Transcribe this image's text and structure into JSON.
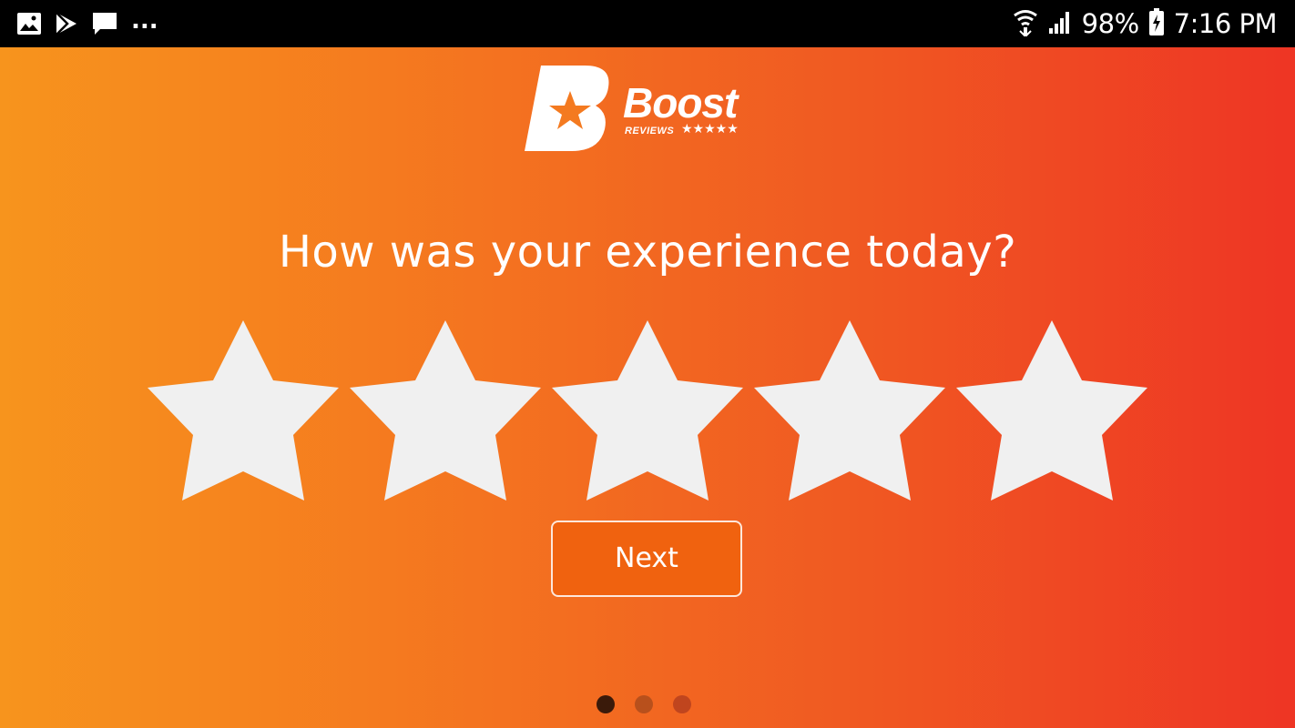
{
  "status_bar": {
    "left_icons": [
      "gallery-icon",
      "play-store-icon",
      "message-icon"
    ],
    "more_indicator": "...",
    "right_icons": [
      "wifi-icon",
      "signal-icon"
    ],
    "battery_percent": "98%",
    "battery_icon": "battery-charging-icon",
    "time": "7:16 PM"
  },
  "logo": {
    "icon": "boost-b-star-logo",
    "wordmark": "Boost",
    "subtext": "REVIEWS",
    "stars": "★★★★★"
  },
  "question": "How was your experience today?",
  "rating": {
    "max_stars": 5,
    "selected": 0,
    "star_color": "#f0f0f0"
  },
  "next_button": {
    "label": "Next"
  },
  "pager": {
    "total": 3,
    "active_index": 0
  },
  "colors": {
    "gradient_start": "#f7941d",
    "gradient_end": "#ee3524",
    "button_fill": "#f0620f",
    "dot_active": "#3a1a0a",
    "dot_inactive": "#b8501c"
  }
}
